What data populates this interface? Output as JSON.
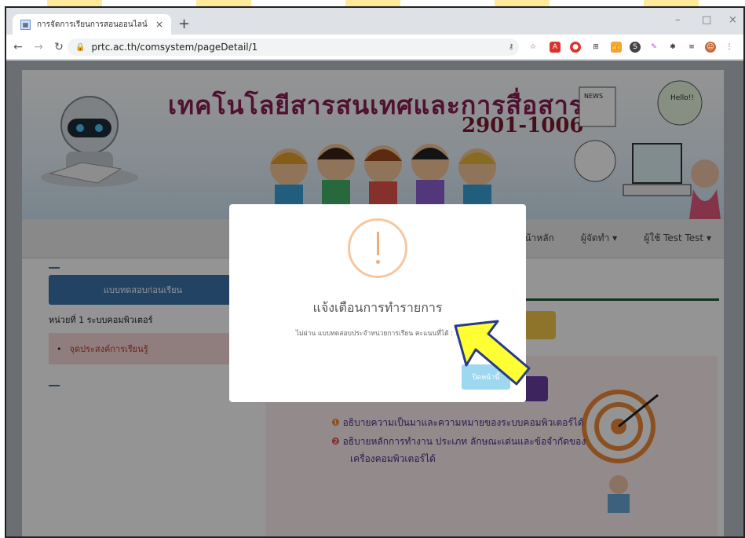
{
  "browser": {
    "tab_title": "การจัดการเรียนการสอนออนไลน์",
    "tab_close": "×",
    "new_tab": "+",
    "url": "prtc.ac.th/comsystem/pageDetail/1",
    "window_controls": {
      "minimize": "–",
      "maximize": "□",
      "close": "×"
    },
    "extensions": [
      "key-icon",
      "star-icon",
      "pdf-icon",
      "red-circle-icon",
      "grid-icon",
      "thumb-icon",
      "s-circle-icon",
      "puzzle-icon",
      "reading-list-icon",
      "profile-avatar-icon",
      "menu-icon"
    ]
  },
  "banner": {
    "title": "เทคโนโลยีสารสนเทศและการสื่อสาร",
    "code": "2901-1006",
    "speech_bubble": "Hello!!",
    "news_label": "NEWS"
  },
  "navbar": {
    "home": "หน้าหลัก",
    "author": "ผู้จัดทำ",
    "user": "ผู้ใช้ Test Test"
  },
  "sidebar": {
    "pretest_button": "แบบทดสอบก่อนเรียน",
    "unit_title": "หน่วยที่ 1 ระบบคอมพิวเตอร์",
    "objective_item": "จุดประสงค์การเรียนรู้"
  },
  "content": {
    "line1": "อธิบายความเป็นมาและความหมายของระบบคอมพิวเตอร์ได้",
    "line2": "อธิบายหลักการทำงาน ประเภท ลักษณะเด่นและข้อจำกัดของ",
    "line3": "เครื่องคอมพิวเตอร์ได้"
  },
  "modal": {
    "title": "แจ้งเตือนการทำรายการ",
    "message": "ไม่ผ่าน แบบทดสอบประจำหน่วยการเรียน คะแนนที่ได้ : 3",
    "close_button": "ปิดหน้านี้"
  },
  "colors": {
    "accent": "#3b74ad",
    "warning_icon": "#f5c7a1",
    "modal_button": "#9dd7f0",
    "arrow_fill": "#ffff33"
  }
}
